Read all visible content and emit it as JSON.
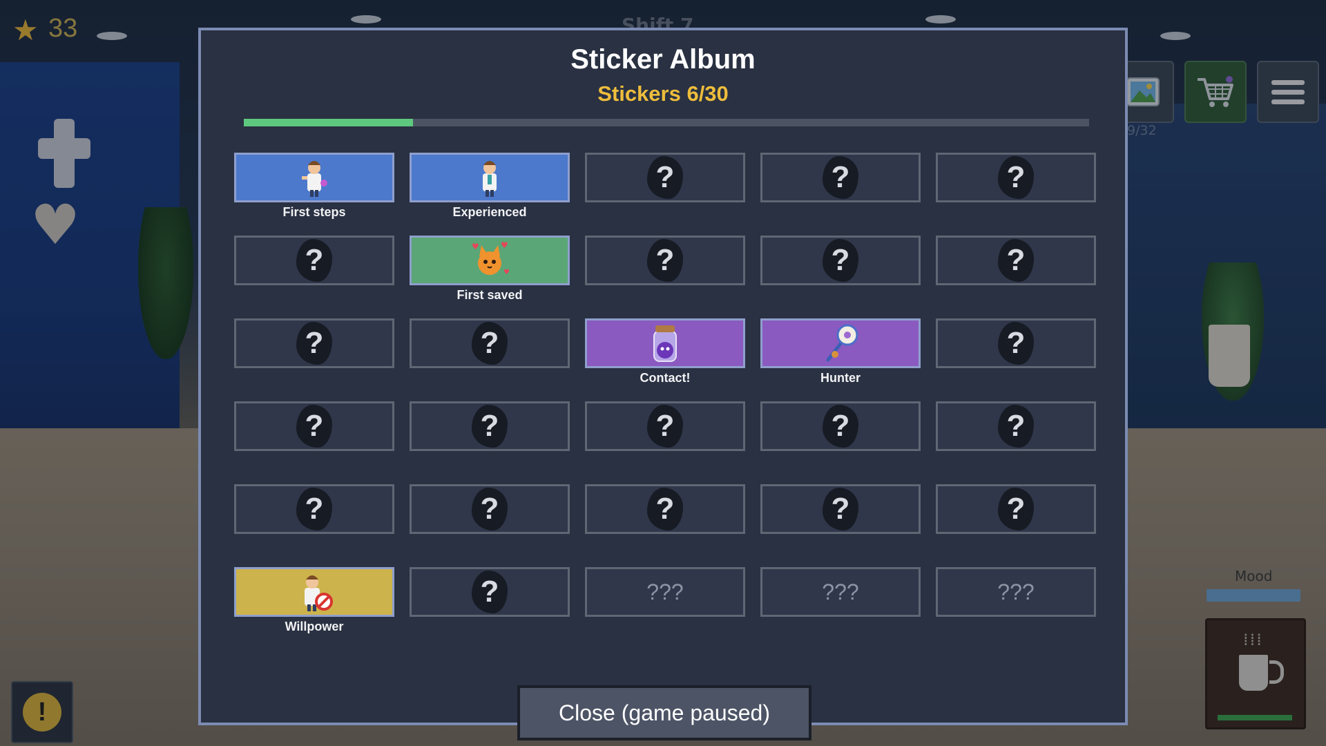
{
  "background": {
    "shift_label": "Shift 7"
  },
  "hud": {
    "coins": "33",
    "gallery_count": "9/32",
    "mood_label": "Mood",
    "icons": [
      "star-icon",
      "gallery-icon",
      "shopping-cart-icon",
      "hamburger-menu-icon",
      "alert-icon",
      "coffee-cup-icon"
    ]
  },
  "album": {
    "title": "Sticker Album",
    "subtitle": "Stickers 6/30",
    "progress_fraction": 0.2,
    "close_label": "Close (game paused)",
    "locked_symbol": "?",
    "hidden_symbol": "???",
    "stickers": [
      {
        "state": "unlocked",
        "label": "First steps",
        "color": "#4c79cc",
        "art": "doctor-thumbs-up"
      },
      {
        "state": "unlocked",
        "label": "Experienced",
        "color": "#4c79cc",
        "art": "doctor-standing"
      },
      {
        "state": "locked"
      },
      {
        "state": "locked"
      },
      {
        "state": "locked"
      },
      {
        "state": "locked"
      },
      {
        "state": "unlocked",
        "label": "First saved",
        "color": "#5aa676",
        "art": "orange-cat-hearts"
      },
      {
        "state": "locked"
      },
      {
        "state": "locked"
      },
      {
        "state": "locked"
      },
      {
        "state": "locked"
      },
      {
        "state": "locked"
      },
      {
        "state": "unlocked",
        "label": "Contact!",
        "color": "#8a5ac0",
        "art": "purple-slime-jar"
      },
      {
        "state": "unlocked",
        "label": "Hunter",
        "color": "#8a5ac0",
        "art": "bug-net"
      },
      {
        "state": "locked"
      },
      {
        "state": "locked"
      },
      {
        "state": "locked"
      },
      {
        "state": "locked"
      },
      {
        "state": "locked"
      },
      {
        "state": "locked"
      },
      {
        "state": "locked"
      },
      {
        "state": "locked"
      },
      {
        "state": "locked"
      },
      {
        "state": "locked"
      },
      {
        "state": "locked"
      },
      {
        "state": "unlocked",
        "label": "Willpower",
        "color": "#cdb34c",
        "art": "doctor-no-smoking"
      },
      {
        "state": "locked"
      },
      {
        "state": "hidden"
      },
      {
        "state": "hidden"
      },
      {
        "state": "hidden"
      }
    ]
  },
  "colors": {
    "accent_gold": "#eebd3c",
    "progress_green": "#5ec87e",
    "modal_border": "#7c8bb2"
  }
}
